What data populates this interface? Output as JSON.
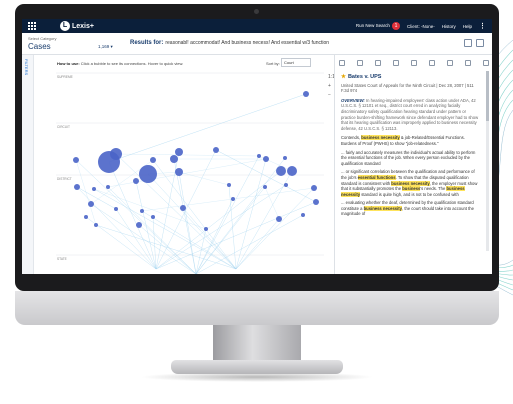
{
  "app": {
    "logo": "Lexis+",
    "logo_mark": "L",
    "header": {
      "run_new_search": "Run New Search",
      "badge": "1",
      "client": "Client: -None-",
      "history": "History",
      "help": "Help",
      "more": "⋮"
    }
  },
  "subheader": {
    "category_label": "Select Category",
    "category_value": "Cases",
    "result_count": "1,169 ▾",
    "results_label": "Results for:",
    "results_query": "reasonabl! accommodat! And business necess! And essential w/3 function",
    "rail_label": "FILTERS"
  },
  "graph_toolbar": {
    "how_to_label": "How to use:",
    "how_to_text": "Click a bubble to see its connections. Hover to quick view.",
    "sort_label": "Sort by:",
    "sort_value": "Court"
  },
  "graph": {
    "tiers": [
      "SUPREME",
      "CIRCUIT",
      "DISTRICT",
      "STATE"
    ],
    "zoom_buttons": [
      "1:1",
      "+",
      "−"
    ],
    "node_color": "#4a64c8",
    "edge_color": "#9bd0ee"
  },
  "document": {
    "title": "Bates v. UPS",
    "court": "United States Court of Appeals for the Ninth Circuit | Dec 28, 2007 | 511 F.3d 974",
    "overview_label": "OVERVIEW:",
    "overview_text": "In hearing-impaired employees' class action under ADA, 42 U.S.C.S. § 12101 et seq., district court erred in analyzing facially discriminatory safety qualification hearing standard under pattern or practice burden-shifting framework since defendant employer had to show that its hearing qualification was improperly applied to business necessity defense, 42 U.S.C.S. § 12113.",
    "p1": [
      "Contends, ",
      "business necessity",
      " & job-Related/Essential Functions. Burdens of Proof (PWHS) to show \"job-relatedness.\""
    ],
    "p2": "... fairly and accurately measures the individual's actual ability to perform the essential functions of the job. When every person excluded by the qualification standard",
    "p3": [
      "... or significant correlation between the qualification and performance of the job's ",
      "essential functions",
      ". To show that the disputed qualification standard is consistent with ",
      "business necessity",
      ", the employer must show that it substantially promotes the ",
      "business",
      "'s needs. The ",
      "business necessity",
      " standard is quite high, and is not to be confused with"
    ],
    "p4": [
      "... evaluating whether the deaf, determined by the qualification standard constitute a ",
      "business necessity",
      ", the court should take into account the magnitude of"
    ]
  }
}
